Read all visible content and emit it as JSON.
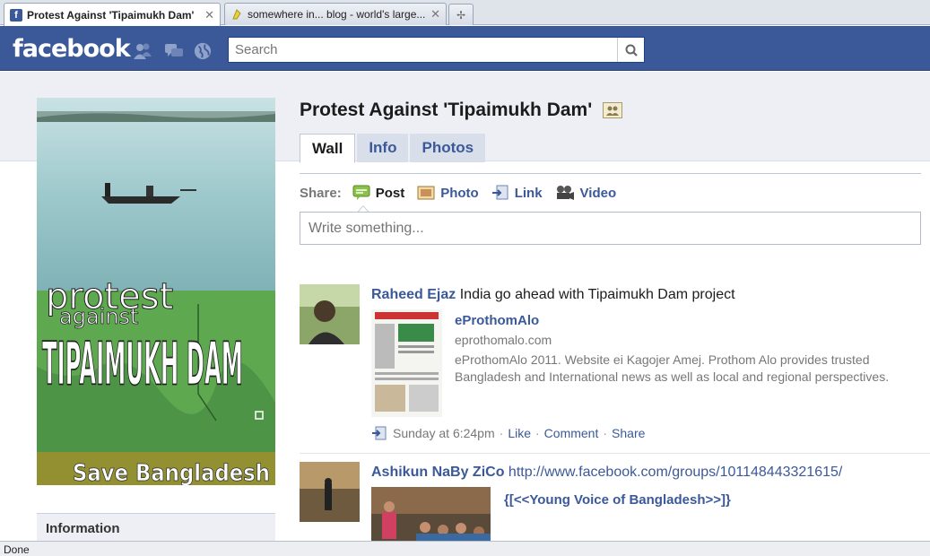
{
  "browser": {
    "tabs": [
      {
        "title": "Protest Against 'Tipaimukh Dam'",
        "favicon": "f",
        "close": "✕"
      },
      {
        "title": "somewhere in... blog - world's large...",
        "close": "✕"
      }
    ],
    "new_tab": "✢",
    "status": "Done"
  },
  "fb": {
    "logo": "facebook",
    "search_placeholder": "Search"
  },
  "page": {
    "title": "Protest Against 'Tipaimukh Dam'",
    "tabs": [
      "Wall",
      "Info",
      "Photos"
    ],
    "profile_text": {
      "line1": "protest",
      "line2": "against",
      "line3": "TIPAIMUKH DAM",
      "line4": "Save Bangladesh"
    },
    "info_label": "Information"
  },
  "share": {
    "label": "Share:",
    "items": [
      "Post",
      "Photo",
      "Link",
      "Video"
    ],
    "composer_placeholder": "Write something..."
  },
  "stories": [
    {
      "actor": "Raheed Ejaz",
      "message": "India go ahead with Tipaimukh Dam project",
      "attachment": {
        "title": "eProthomAlo",
        "url": "eprothomalo.com",
        "desc1": "eProthomAlo 2011. Website ei Kagojer Amej. Prothom Alo provides trusted",
        "desc2": "Bangladesh and International news as well as local and regional perspectives."
      },
      "time": "Sunday at 6:24pm",
      "actions": [
        "Like",
        "Comment",
        "Share"
      ]
    },
    {
      "actor": "Ashikun NaBy ZiCo",
      "message_link": "http://www.facebook.com/groups/101148443321615/",
      "attachment_title": "{[<<Young Voice of Bangladesh>>]}"
    }
  ],
  "colors": {
    "fb_blue": "#3b5998",
    "band": "#edeff4"
  }
}
